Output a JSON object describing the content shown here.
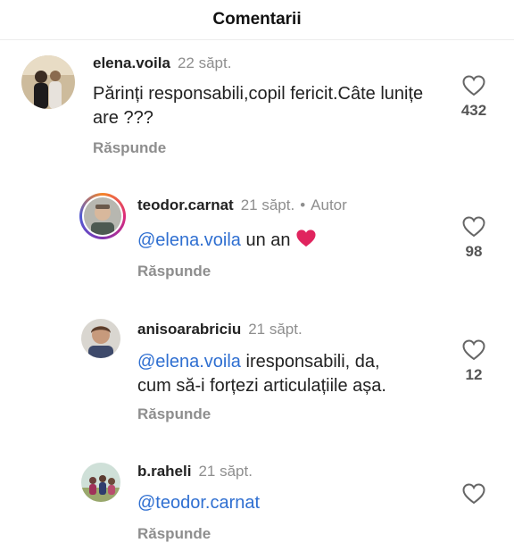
{
  "header": {
    "title": "Comentarii"
  },
  "colors": {
    "mention": "#2f6fd1",
    "heart": "#e0245e",
    "muted": "#8e8e8e"
  },
  "comments": [
    {
      "username": "elena.voila",
      "time": "22 săpt.",
      "text": "Părinți responsabili,copil fericit.Câte lunițe are ???",
      "reply_label": "Răspunde",
      "likes": "432",
      "avatar_icon": "profile-photo"
    },
    {
      "username": "teodor.carnat",
      "time": "21 săpt.",
      "separator": "•",
      "author_label": "Autor",
      "mention": "@elena.voila",
      "text": "un an",
      "emoji": "heart",
      "reply_label": "Răspunde",
      "likes": "98",
      "avatar_icon": "profile-photo-story-ring"
    },
    {
      "username": "anisoarabriciu",
      "time": "21 săpt.",
      "mention": "@elena.voila",
      "text_line1": "iresponsabili, da,",
      "text_line2": "cum să-i forțezi articulațiile așa.",
      "reply_label": "Răspunde",
      "likes": "12",
      "avatar_icon": "profile-photo"
    },
    {
      "username": "b.raheli",
      "time": "21 săpt.",
      "mention": "@teodor.carnat",
      "reply_label": "Răspunde",
      "avatar_icon": "profile-photo"
    }
  ]
}
